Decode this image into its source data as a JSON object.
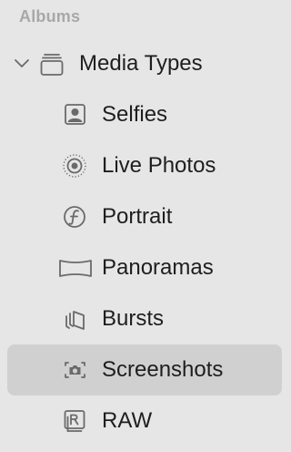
{
  "sidebar": {
    "section_title": "Albums",
    "group": {
      "label": "Media Types",
      "icon": "stack-icon",
      "expanded": true
    },
    "items": [
      {
        "label": "Selfies",
        "icon": "selfie-icon",
        "selected": false
      },
      {
        "label": "Live Photos",
        "icon": "live-photo-icon",
        "selected": false
      },
      {
        "label": "Portrait",
        "icon": "portrait-icon",
        "selected": false
      },
      {
        "label": "Panoramas",
        "icon": "panorama-icon",
        "selected": false
      },
      {
        "label": "Bursts",
        "icon": "burst-icon",
        "selected": false
      },
      {
        "label": "Screenshots",
        "icon": "screenshot-icon",
        "selected": true
      },
      {
        "label": "RAW",
        "icon": "raw-icon",
        "selected": false
      }
    ]
  },
  "colors": {
    "background": "#e7e6e6",
    "selected_row": "#d0d0d0",
    "section_title": "#a8a8a8",
    "text": "#1e1e1e",
    "icon": "#6a6a6a"
  }
}
